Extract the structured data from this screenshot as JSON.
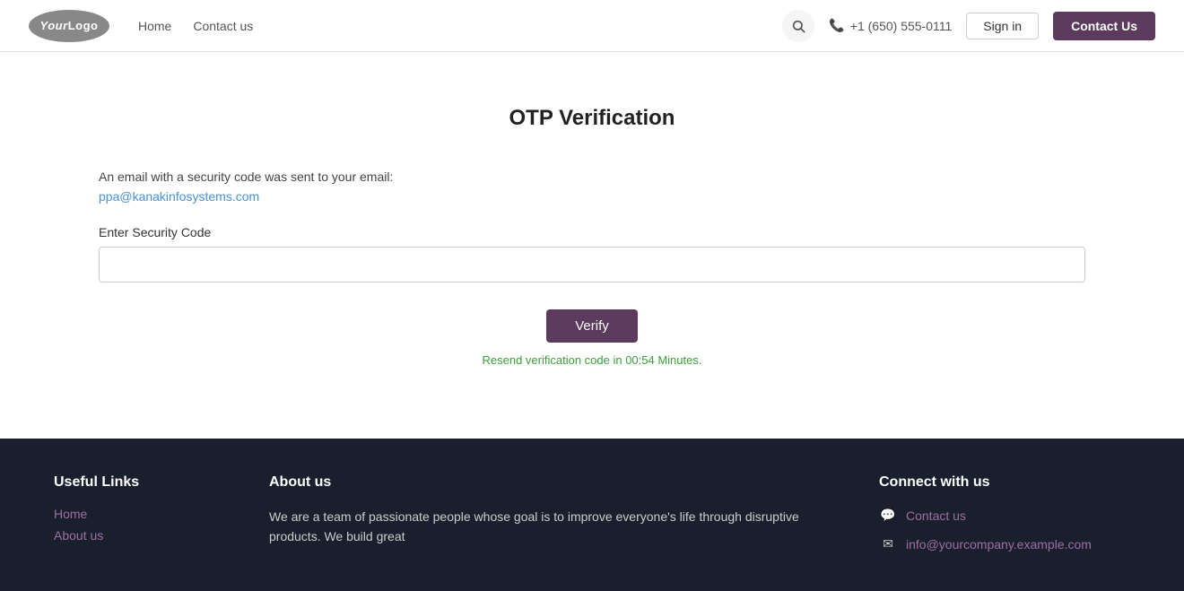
{
  "navbar": {
    "logo_text": "YourLogo",
    "logo_your": "Your",
    "logo_logo": "Logo",
    "links": [
      {
        "label": "Home",
        "href": "#"
      },
      {
        "label": "Contact us",
        "href": "#"
      }
    ],
    "phone_icon": "📞",
    "phone_number": "+1 (650) 555-0111",
    "signin_label": "Sign in",
    "contact_us_label": "Contact Us",
    "search_placeholder": "Search"
  },
  "main": {
    "title": "OTP Verification",
    "email_notice_line1": "An email with a security code was sent to your email:",
    "email_address": "ppa@kanakinfosystems.com",
    "field_label": "Enter Security Code",
    "security_code_placeholder": "",
    "verify_button_label": "Verify",
    "resend_text": "Resend verification code in 00:54 Minutes."
  },
  "footer": {
    "useful_links_title": "Useful Links",
    "useful_links": [
      {
        "label": "Home",
        "href": "#"
      },
      {
        "label": "About us",
        "href": "#"
      }
    ],
    "about_title": "About us",
    "about_text": "We are a team of passionate people whose goal is to improve everyone's life through disruptive products. We build great",
    "connect_title": "Connect with us",
    "connect_items": [
      {
        "icon": "💬",
        "label": "Contact us",
        "href": "#"
      },
      {
        "icon": "✉",
        "label": "info@yourcompany.example.com",
        "href": "#"
      }
    ]
  }
}
